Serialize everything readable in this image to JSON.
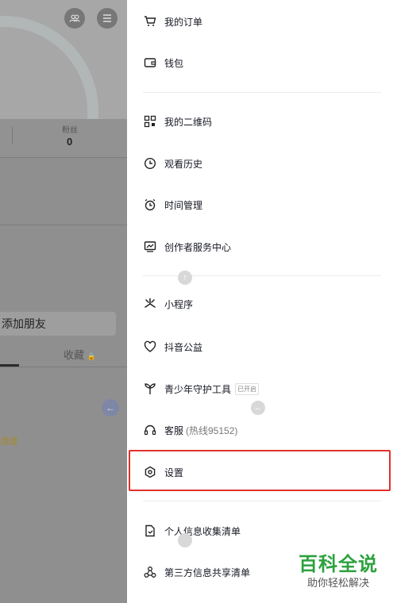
{
  "background": {
    "fans_label": "粉丝",
    "fans_count": "0",
    "add_friend": "添加朋友",
    "tab_favorites": "收藏",
    "lock_glyph": "🔒",
    "clean_text": "清理",
    "friends_icon": "friends-icon",
    "menu_icon": "menu-icon"
  },
  "drawer": {
    "items": [
      {
        "label": "我的订单",
        "icon": "cart-icon"
      },
      {
        "label": "钱包",
        "icon": "wallet-icon"
      },
      {
        "label": "我的二维码",
        "icon": "qrcode-icon"
      },
      {
        "label": "观看历史",
        "icon": "clock-icon"
      },
      {
        "label": "时间管理",
        "icon": "alarm-icon"
      },
      {
        "label": "创作者服务中心",
        "icon": "creator-icon"
      },
      {
        "label": "小程序",
        "icon": "mini-program-icon"
      },
      {
        "label": "抖音公益",
        "icon": "charity-icon"
      },
      {
        "label": "青少年守护工具",
        "icon": "sprout-icon",
        "badge": "已开启"
      },
      {
        "label": "客服",
        "icon": "headset-icon",
        "sub": "(热线95152)"
      },
      {
        "label": "设置",
        "icon": "settings-icon"
      },
      {
        "label": "个人信息收集清单",
        "icon": "doc-icon"
      },
      {
        "label": "第三方信息共享清单",
        "icon": "share-icon"
      }
    ]
  },
  "watermark": {
    "title": "百科全说",
    "subtitle": "助你轻松解决"
  },
  "colors": {
    "highlight": "#e0312b",
    "watermark": "#2da13d"
  }
}
